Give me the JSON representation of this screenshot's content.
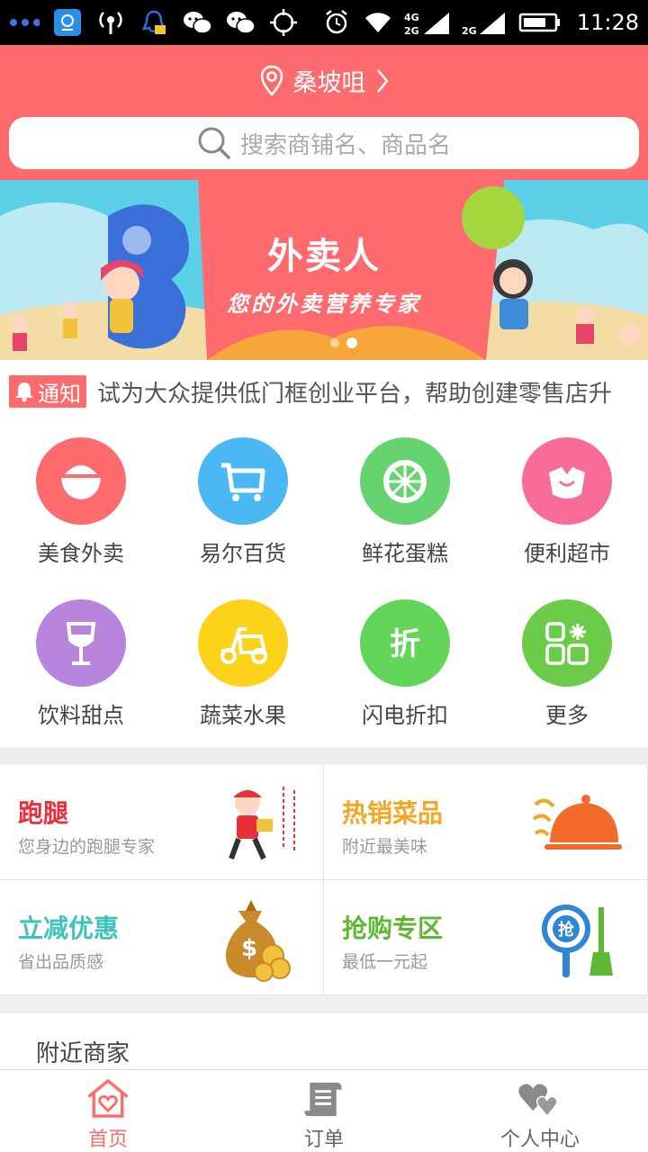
{
  "status_bar": {
    "time": "11:28",
    "icons": [
      "dots-icon",
      "app-icon",
      "hotspot-icon",
      "qq-icon",
      "wechat-icon",
      "wechat-icon",
      "gps-icon",
      "alarm-icon",
      "wifi-icon",
      "signal-4g-icon",
      "signal-2g-icon",
      "battery-icon"
    ],
    "net_labels": [
      "4G",
      "2G",
      "2G"
    ]
  },
  "header": {
    "location": "桑坡咀",
    "search_placeholder": "搜索商铺名、商品名",
    "bg_color": "#fd6b6e"
  },
  "banner": {
    "title": "外卖人",
    "subtitle": "您的外卖营养专家",
    "active_dot": 2,
    "dot_count": 2
  },
  "notice": {
    "tag": "通知",
    "text": "试为大众提供低门框创业平台，帮助创建零售店升"
  },
  "categories": [
    {
      "label": "美食外卖",
      "icon": "bowl-icon",
      "color": "#fd6b6e"
    },
    {
      "label": "易尔百货",
      "icon": "cart-icon",
      "color": "#4ab8f2"
    },
    {
      "label": "鲜花蛋糕",
      "icon": "lime-icon",
      "color": "#65d36f"
    },
    {
      "label": "便利超市",
      "icon": "bag-icon",
      "color": "#f76d98"
    },
    {
      "label": "饮料甜点",
      "icon": "wine-icon",
      "color": "#b885dd"
    },
    {
      "label": "蔬菜水果",
      "icon": "scooter-icon",
      "color": "#fcd21b"
    },
    {
      "label": "闪电折扣",
      "icon": "discount-icon",
      "color": "#63d55b"
    },
    {
      "label": "更多",
      "icon": "more-grid-icon",
      "color": "#6ccc4a"
    }
  ],
  "promos": [
    {
      "title": "跑腿",
      "subtitle": "您身边的跑腿专家",
      "color": "#e8303a",
      "icon": "courier-icon"
    },
    {
      "title": "热销菜品",
      "subtitle": "附近最美味",
      "color": "#f5a623",
      "icon": "cloche-icon"
    },
    {
      "title": "立减优惠",
      "subtitle": "省出品质感",
      "color": "#3fc2ba",
      "icon": "money-bag-icon"
    },
    {
      "title": "抢购专区",
      "subtitle": "最低一元起",
      "color": "#5fb832",
      "icon": "grab-icon"
    }
  ],
  "nearby": {
    "title": "附近商家"
  },
  "tabs": [
    {
      "label": "首页",
      "icon": "home-heart-icon",
      "active": true
    },
    {
      "label": "订单",
      "icon": "order-scroll-icon",
      "active": false
    },
    {
      "label": "个人中心",
      "icon": "hearts-icon",
      "active": false
    }
  ],
  "colors": {
    "accent": "#fd6b6e",
    "tab_inactive": "#666666",
    "tab_icon_inactive": "#8a8a8a"
  }
}
